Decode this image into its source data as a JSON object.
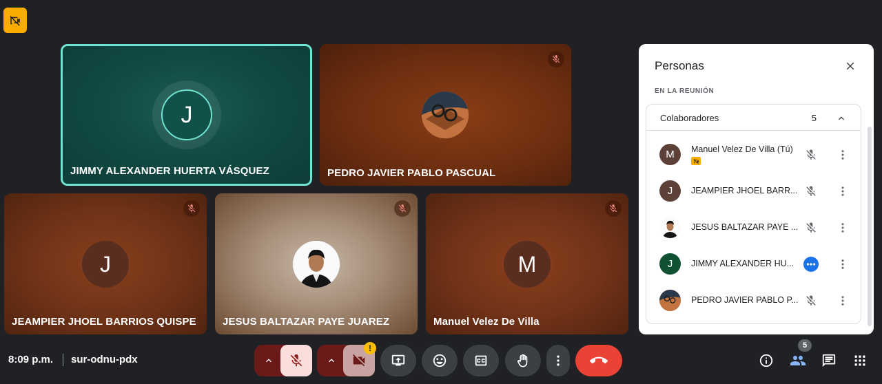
{
  "tiles": [
    {
      "name": "JIMMY ALEXANDER HUERTA VÁSQUEZ",
      "initial": "J",
      "speaking": true
    },
    {
      "name": "PEDRO JAVIER PABLO PASCUAL",
      "muted": true
    },
    {
      "name": "JEAMPIER JHOEL BARRIOS QUISPE",
      "initial": "J",
      "muted": true
    },
    {
      "name": "JESUS BALTAZAR PAYE JUAREZ",
      "muted": true
    },
    {
      "name": "Manuel Velez De Villa",
      "initial": "M",
      "muted": true
    }
  ],
  "panel": {
    "title": "Personas",
    "section": "EN LA REUNIÓN",
    "group_name": "Colaboradores",
    "group_count": "5",
    "people": [
      {
        "name": "Manuel Velez De Villa (Tú)",
        "initial": "M",
        "color": "#5d4037",
        "status": "muted"
      },
      {
        "name": "JEAMPIER JHOEL BARR...",
        "initial": "J",
        "color": "#5d4037",
        "status": "muted"
      },
      {
        "name": "JESUS BALTAZAR PAYE ...",
        "initial": "",
        "color": "#ffffff",
        "status": "muted"
      },
      {
        "name": "JIMMY ALEXANDER HU...",
        "initial": "J",
        "color": "#0f5132",
        "status": "speaking"
      },
      {
        "name": "PEDRO JAVIER PABLO P...",
        "initial": "",
        "color": "#b5683a",
        "status": "muted"
      }
    ]
  },
  "bottom": {
    "time": "8:09 p.m.",
    "meeting_code": "sur-odnu-pdx",
    "people_count": "5",
    "camera_warning": "!"
  },
  "colors": {
    "background": "#202124",
    "end_call": "#ea4335",
    "active_speaker_border": "#6fe3cf",
    "warning": "#fbbc04"
  }
}
